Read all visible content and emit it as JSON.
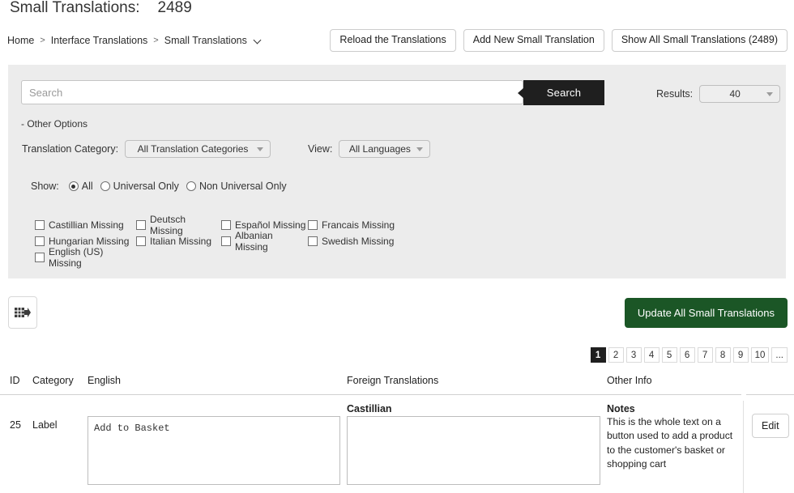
{
  "header": {
    "title": "Small Translations:",
    "count": "2489",
    "breadcrumb": [
      {
        "label": "Home",
        "icon": null
      },
      {
        "label": "Interface Translations",
        "icon": null
      },
      {
        "label": "Small Translations",
        "icon": "chevron-down-icon"
      }
    ],
    "separator": ">",
    "actions": [
      {
        "label": "Reload the Translations",
        "name": "reload-translations-button"
      },
      {
        "label": "Add New Small Translation",
        "name": "add-new-small-translation-button"
      },
      {
        "label": "Show All Small Translations (2489)",
        "name": "show-all-small-translations-button"
      }
    ]
  },
  "filters": {
    "search": {
      "placeholder": "Search",
      "value": "",
      "button_label": "Search"
    },
    "results": {
      "label": "Results:",
      "value": "40"
    },
    "other_options_label": "- Other Options",
    "translation_category": {
      "label": "Translation Category:",
      "value": "All Translation Categories"
    },
    "view": {
      "label": "View:",
      "value": "All Languages"
    },
    "show": {
      "label": "Show:",
      "options": [
        {
          "label": "All",
          "checked": true
        },
        {
          "label": "Universal Only",
          "checked": false
        },
        {
          "label": "Non Universal Only",
          "checked": false
        }
      ]
    },
    "missing_checkboxes": [
      {
        "label": "Castillian Missing",
        "checked": false
      },
      {
        "label": "Deutsch Missing",
        "checked": false
      },
      {
        "label": "Español Missing",
        "checked": false
      },
      {
        "label": "Francais Missing",
        "checked": false
      },
      {
        "label": "Hungarian Missing",
        "checked": false
      },
      {
        "label": "Italian Missing",
        "checked": false
      },
      {
        "label": "Albanian Missing",
        "checked": false
      },
      {
        "label": "Swedish Missing",
        "checked": false
      },
      {
        "label": "English (US) Missing",
        "checked": false
      }
    ]
  },
  "toolbar": {
    "export_icon": "table-export-icon",
    "update_label": "Update All Small Translations",
    "update_color": "#1b5626"
  },
  "pagination": {
    "pages": [
      "1",
      "2",
      "3",
      "4",
      "5",
      "6",
      "7",
      "8",
      "9",
      "10",
      "..."
    ],
    "active": "1"
  },
  "table": {
    "columns": [
      "ID",
      "Category",
      "English",
      "Foreign Translations",
      "Other Info"
    ],
    "rows": [
      {
        "id": "25",
        "category": "Label",
        "english": "Add to Basket",
        "foreign_label": "Castillian",
        "foreign_value": "",
        "notes_title": "Notes",
        "notes_text": "This is the whole text on a button used to add a product to the customer's basket or shopping cart",
        "edit_label": "Edit"
      }
    ]
  }
}
